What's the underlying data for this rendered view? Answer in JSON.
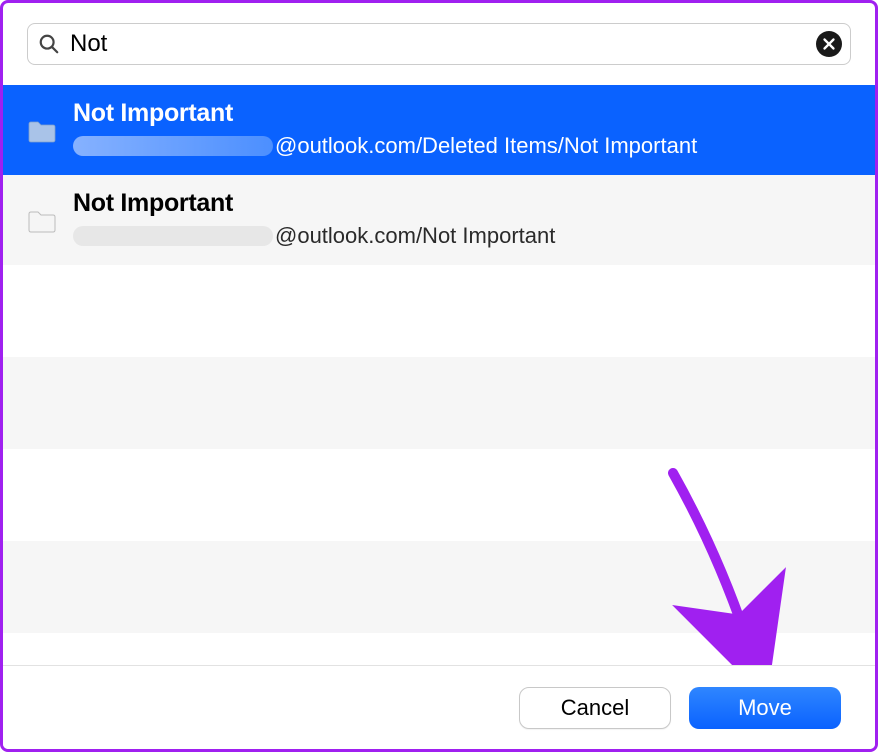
{
  "search": {
    "value": "Not "
  },
  "results": [
    {
      "title": "Not Important",
      "path_suffix": "@outlook.com/Deleted Items/Not Important",
      "selected": true
    },
    {
      "title": "Not Important",
      "path_suffix": "@outlook.com/Not Important",
      "selected": false
    }
  ],
  "buttons": {
    "cancel": "Cancel",
    "move": "Move"
  }
}
